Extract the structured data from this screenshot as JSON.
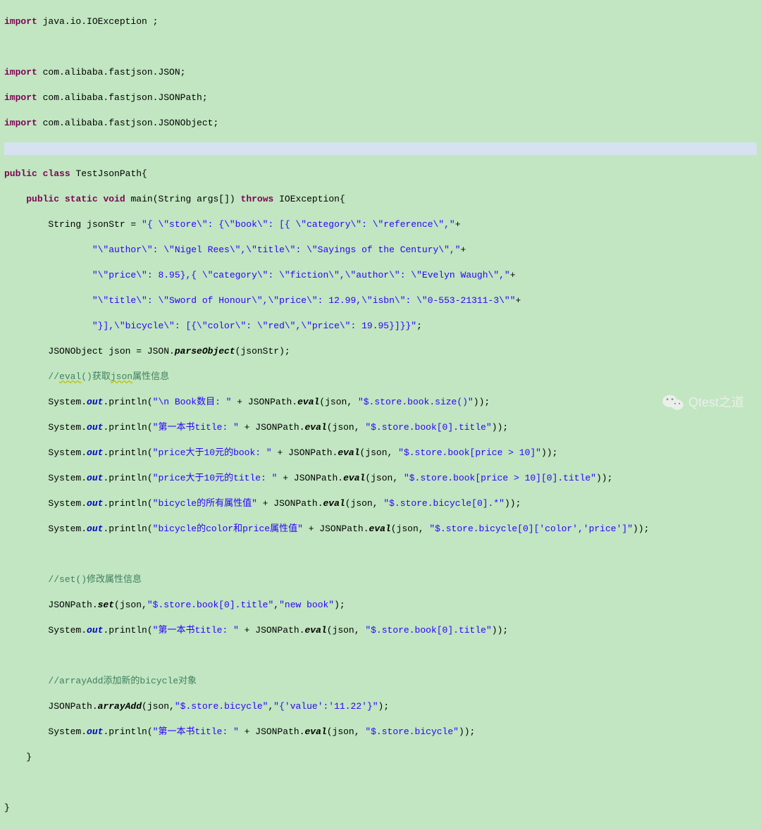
{
  "lines": {
    "l1_kw": "import",
    "l1_rest": " java.io.IOException ;",
    "l3_kw": "import",
    "l3_rest": " com.alibaba.fastjson.JSON;",
    "l4_kw": "import",
    "l4_rest": " com.alibaba.fastjson.JSONPath;",
    "l5_kw": "import",
    "l5_rest": " com.alibaba.fastjson.JSONObject;",
    "l7_public": "public",
    "l7_class": "class",
    "l7_rest": " TestJsonPath{",
    "l8_public": "public",
    "l8_static": "static",
    "l8_void": "void",
    "l8_main": " main(String args[]) ",
    "l8_throws": "throws",
    "l8_rest": " IOException{",
    "l9_pre": "        String jsonStr = ",
    "l9_str": "\"{ \\\"store\\\": {\\\"book\\\": [{ \\\"category\\\": \\\"reference\\\",\"",
    "l9_post": "+",
    "l10_str": "\"\\\"author\\\": \\\"Nigel Rees\\\",\\\"title\\\": \\\"Sayings of the Century\\\",\"",
    "l10_post": "+",
    "l11_str": "\"\\\"price\\\": 8.95},{ \\\"category\\\": \\\"fiction\\\",\\\"author\\\": \\\"Evelyn Waugh\\\",\"",
    "l11_post": "+",
    "l12_str": "\"\\\"title\\\": \\\"Sword of Honour\\\",\\\"price\\\": 12.99,\\\"isbn\\\": \\\"0-553-21311-3\\\"\"",
    "l12_post": "+",
    "l13_str": "\"}],\\\"bicycle\\\": [{\\\"color\\\": \\\"red\\\",\\\"price\\\": 19.95}]}}\"",
    "l13_post": ";",
    "l14_pre": "        JSONObject json = JSON.",
    "l14_m": "parseObject",
    "l14_post": "(jsonStr);",
    "l15_com": "//",
    "l15_eval": "eval",
    "l15_com2": "()获取",
    "l15_json": "json",
    "l15_com3": "属性信息",
    "l16_pre": "        System.",
    "l16_out": "out",
    "l16_mid": ".println(",
    "l16_str": "\"\\n Book数目: \"",
    "l16_mid2": " + JSONPath.",
    "l16_eval": "eval",
    "l16_post": "(json, ",
    "l16_str2": "\"$.store.book.size()\"",
    "l16_end": "));",
    "l17_str": "\"第一本书title: \"",
    "l17_str2": "\"$.store.book[0].title\"",
    "l18_str": "\"price大于10元的book: \"",
    "l18_str2": "\"$.store.book[price > 10]\"",
    "l19_str": "\"price大于10元的title: \"",
    "l19_str2": "\"$.store.book[price > 10][0].title\"",
    "l20_str": "\"bicycle的所有属性值\"",
    "l20_str2": "\"$.store.bicycle[0].*\"",
    "l21_str": "\"bicycle的color和price属性值\"",
    "l21_str2": "\"$.store.bicycle[0]['color','price']\"",
    "l23_com": "//set()修改属性信息",
    "l24_pre": "        JSONPath.",
    "l24_m": "set",
    "l24_post": "(json,",
    "l24_str": "\"$.store.book[0].title\"",
    "l24_mid": ",",
    "l24_str2": "\"new book\"",
    "l24_end": ");",
    "l25_str": "\"第一本书title: \"",
    "l25_str2": "\"$.store.book[0].title\"",
    "l27_com": "//arrayAdd添加新的bicycle对象",
    "l28_pre": "        JSONPath.",
    "l28_m": "arrayAdd",
    "l28_post": "(json,",
    "l28_str": "\"$.store.bicycle\"",
    "l28_mid": ",",
    "l28_str2": "\"{'value':'11.22'}\"",
    "l28_end": ");",
    "l29_str": "\"第一本书title: \"",
    "l29_str2": "\"$.store.bicycle\"",
    "l30": "    }",
    "l32": "}",
    "indent_str": "                ",
    "indent_com": "        ",
    "watermark": "Qtest之道"
  }
}
